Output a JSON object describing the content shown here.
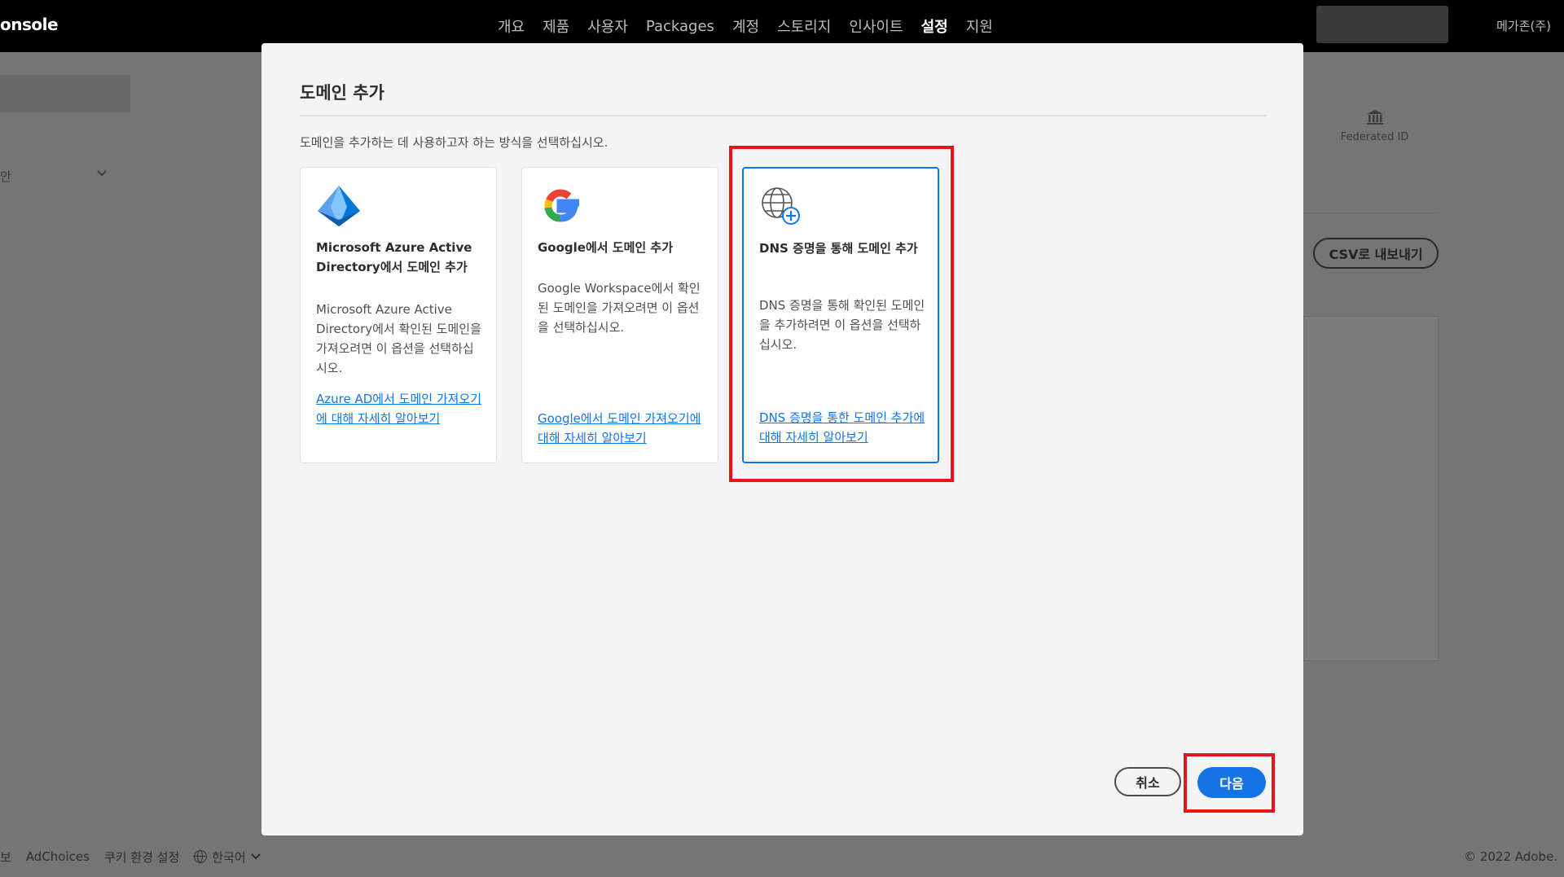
{
  "topbar": {
    "brand": "onsole",
    "nav": [
      "개요",
      "제품",
      "사용자",
      "Packages",
      "계정",
      "스토리지",
      "인사이트",
      "설정",
      "지원"
    ],
    "active_nav": "설정",
    "org": "메가존(주)"
  },
  "background": {
    "side_text": "안",
    "federated_label": "Federated ID",
    "csv_button": "CSV로 내보내기"
  },
  "footer": {
    "items": [
      "보",
      "AdChoices",
      "쿠키 환경 설정"
    ],
    "language": "한국어",
    "copyright": "© 2022 Adobe."
  },
  "modal": {
    "title": "도메인 추가",
    "description": "도메인을 추가하는 데 사용하고자 하는 방식을 선택하십시오.",
    "cards": [
      {
        "icon": "azure-icon",
        "title": "Microsoft Azure Active Directory에서 도메인 추가",
        "body": "Microsoft Azure Active Directory에서 확인된 도메인을 가져오려면 이 옵션을 선택하십시오.",
        "link": "Azure AD에서 도메인 가져오기에 대해 자세히 알아보기",
        "selected": false
      },
      {
        "icon": "google-icon",
        "title": "Google에서 도메인 추가",
        "body": "Google Workspace에서 확인된 도메인을 가져오려면 이 옵션을 선택하십시오.",
        "link": "Google에서 도메인 가져오기에 대해 자세히 알아보기",
        "selected": false
      },
      {
        "icon": "globe-add-icon",
        "title": "DNS 증명을 통해 도메인 추가",
        "body": "DNS 증명을 통해 확인된 도메인을 추가하려면 이 옵션을 선택하십시오.",
        "link": "DNS 증명을 통한 도메인 추가에 대해 자세히 알아보기",
        "selected": true
      }
    ],
    "cancel": "취소",
    "next": "다음"
  },
  "colors": {
    "accent": "#1473e6",
    "highlight": "#e8141b"
  }
}
